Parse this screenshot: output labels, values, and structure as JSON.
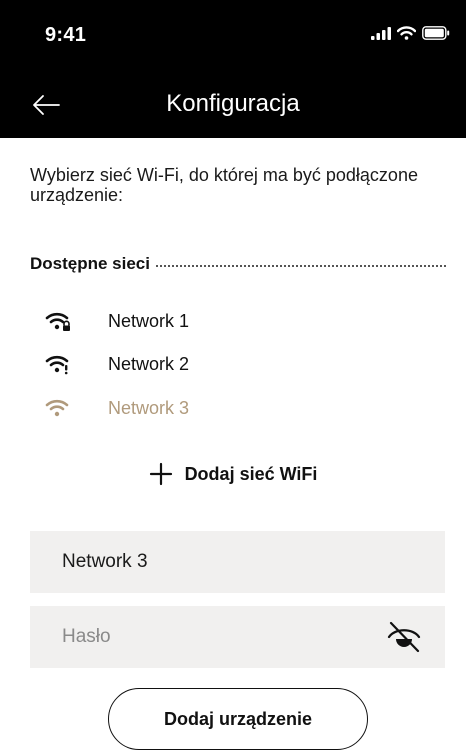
{
  "status_bar": {
    "time": "9:41",
    "icons": [
      "signal-icon",
      "wifi-icon",
      "battery-icon"
    ]
  },
  "nav": {
    "title": "Konfiguracja",
    "back_icon": "arrow-left-icon"
  },
  "intro_text": "Wybierz sieć Wi-Fi, do której ma być podłączone urządzenie:",
  "networks_section": {
    "title": "Dostępne sieci",
    "items": [
      {
        "label": "Network 1",
        "icon": "wifi-locked-icon",
        "selected": false
      },
      {
        "label": "Network 2",
        "icon": "wifi-warning-icon",
        "selected": false
      },
      {
        "label": "Network 3",
        "icon": "wifi-icon",
        "selected": true
      }
    ]
  },
  "add_network": {
    "label": "Dodaj sieć WiFi",
    "icon": "plus-icon"
  },
  "form": {
    "ssid_value": "Network 3",
    "password_placeholder": "Hasło",
    "password_toggle_icon": "eye-off-icon"
  },
  "submit_label": "Dodaj urządzenie",
  "colors": {
    "header_bg": "#000000",
    "accent": "#b09a7c",
    "field_bg": "#f1f0ef"
  }
}
